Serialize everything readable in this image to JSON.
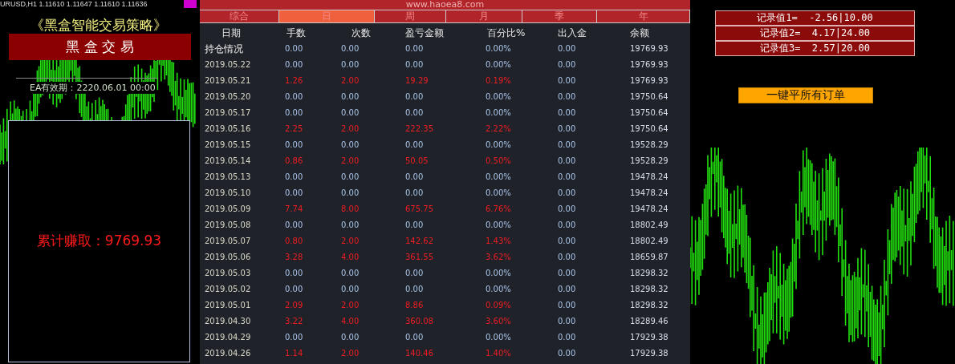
{
  "chart_header": {
    "symbol_quote": "URUSD,H1  1.11610 1.11647 1.11610 1.11636"
  },
  "left_panel": {
    "strategy_title": "《黑盒智能交易策略》",
    "banner": "黑 盒 交 易",
    "expiry": "EA有效期：2220.06.01 00:00",
    "total_profit": "累计赚取：9769.93"
  },
  "report": {
    "site": "www.haoea8.com",
    "tabs": [
      {
        "label": "综合",
        "selected": false
      },
      {
        "label": "日",
        "selected": true
      },
      {
        "label": "周",
        "selected": false
      },
      {
        "label": "月",
        "selected": false
      },
      {
        "label": "季",
        "selected": false
      },
      {
        "label": "年",
        "selected": false
      }
    ],
    "columns": [
      "日期",
      "手数",
      "次数",
      "盈亏金额",
      "百分比%",
      "出入金",
      "余额"
    ],
    "rows": [
      {
        "cells": [
          "持仓情况",
          "0.00",
          "0.00",
          "0.00",
          "0.00%",
          "0.00",
          "19769.93"
        ],
        "highlighted": false
      },
      {
        "cells": [
          "2019.05.22",
          "0.00",
          "0.00",
          "0.00",
          "0.00%",
          "0.00",
          "19769.93"
        ],
        "highlighted": false
      },
      {
        "cells": [
          "2019.05.21",
          "1.26",
          "2.00",
          "19.29",
          "0.19%",
          "0.00",
          "19769.93"
        ],
        "highlighted": true
      },
      {
        "cells": [
          "2019.05.20",
          "0.00",
          "0.00",
          "0.00",
          "0.00%",
          "0.00",
          "19750.64"
        ],
        "highlighted": false
      },
      {
        "cells": [
          "2019.05.17",
          "0.00",
          "0.00",
          "0.00",
          "0.00%",
          "0.00",
          "19750.64"
        ],
        "highlighted": false
      },
      {
        "cells": [
          "2019.05.16",
          "2.25",
          "2.00",
          "222.35",
          "2.22%",
          "0.00",
          "19750.64"
        ],
        "highlighted": true
      },
      {
        "cells": [
          "2019.05.15",
          "0.00",
          "0.00",
          "0.00",
          "0.00%",
          "0.00",
          "19528.29"
        ],
        "highlighted": false
      },
      {
        "cells": [
          "2019.05.14",
          "0.86",
          "2.00",
          "50.05",
          "0.50%",
          "0.00",
          "19528.29"
        ],
        "highlighted": true
      },
      {
        "cells": [
          "2019.05.13",
          "0.00",
          "0.00",
          "0.00",
          "0.00%",
          "0.00",
          "19478.24"
        ],
        "highlighted": false
      },
      {
        "cells": [
          "2019.05.10",
          "0.00",
          "0.00",
          "0.00",
          "0.00%",
          "0.00",
          "19478.24"
        ],
        "highlighted": false
      },
      {
        "cells": [
          "2019.05.09",
          "7.74",
          "8.00",
          "675.75",
          "6.76%",
          "0.00",
          "19478.24"
        ],
        "highlighted": true
      },
      {
        "cells": [
          "2019.05.08",
          "0.00",
          "0.00",
          "0.00",
          "0.00%",
          "0.00",
          "18802.49"
        ],
        "highlighted": false
      },
      {
        "cells": [
          "2019.05.07",
          "0.80",
          "2.00",
          "142.62",
          "1.43%",
          "0.00",
          "18802.49"
        ],
        "highlighted": true
      },
      {
        "cells": [
          "2019.05.06",
          "3.28",
          "4.00",
          "361.55",
          "3.62%",
          "0.00",
          "18659.87"
        ],
        "highlighted": true
      },
      {
        "cells": [
          "2019.05.03",
          "0.00",
          "0.00",
          "0.00",
          "0.00%",
          "0.00",
          "18298.32"
        ],
        "highlighted": false
      },
      {
        "cells": [
          "2019.05.02",
          "0.00",
          "0.00",
          "0.00",
          "0.00%",
          "0.00",
          "18298.32"
        ],
        "highlighted": false
      },
      {
        "cells": [
          "2019.05.01",
          "2.09",
          "2.00",
          "8.86",
          "0.09%",
          "0.00",
          "18298.32"
        ],
        "highlighted": true
      },
      {
        "cells": [
          "2019.04.30",
          "3.22",
          "4.00",
          "360.08",
          "3.60%",
          "0.00",
          "18289.46"
        ],
        "highlighted": true
      },
      {
        "cells": [
          "2019.04.29",
          "0.00",
          "0.00",
          "0.00",
          "0.00%",
          "0.00",
          "17929.38"
        ],
        "highlighted": false
      },
      {
        "cells": [
          "2019.04.26",
          "1.14",
          "2.00",
          "140.46",
          "1.40%",
          "0.00",
          "17929.38"
        ],
        "highlighted": true
      }
    ]
  },
  "records": [
    "记录值1=  -2.56|10.00",
    "记录值2=  4.17|24.00",
    "记录值3=  2.57|20.00"
  ],
  "close_all_button": "一键平所有订单"
}
